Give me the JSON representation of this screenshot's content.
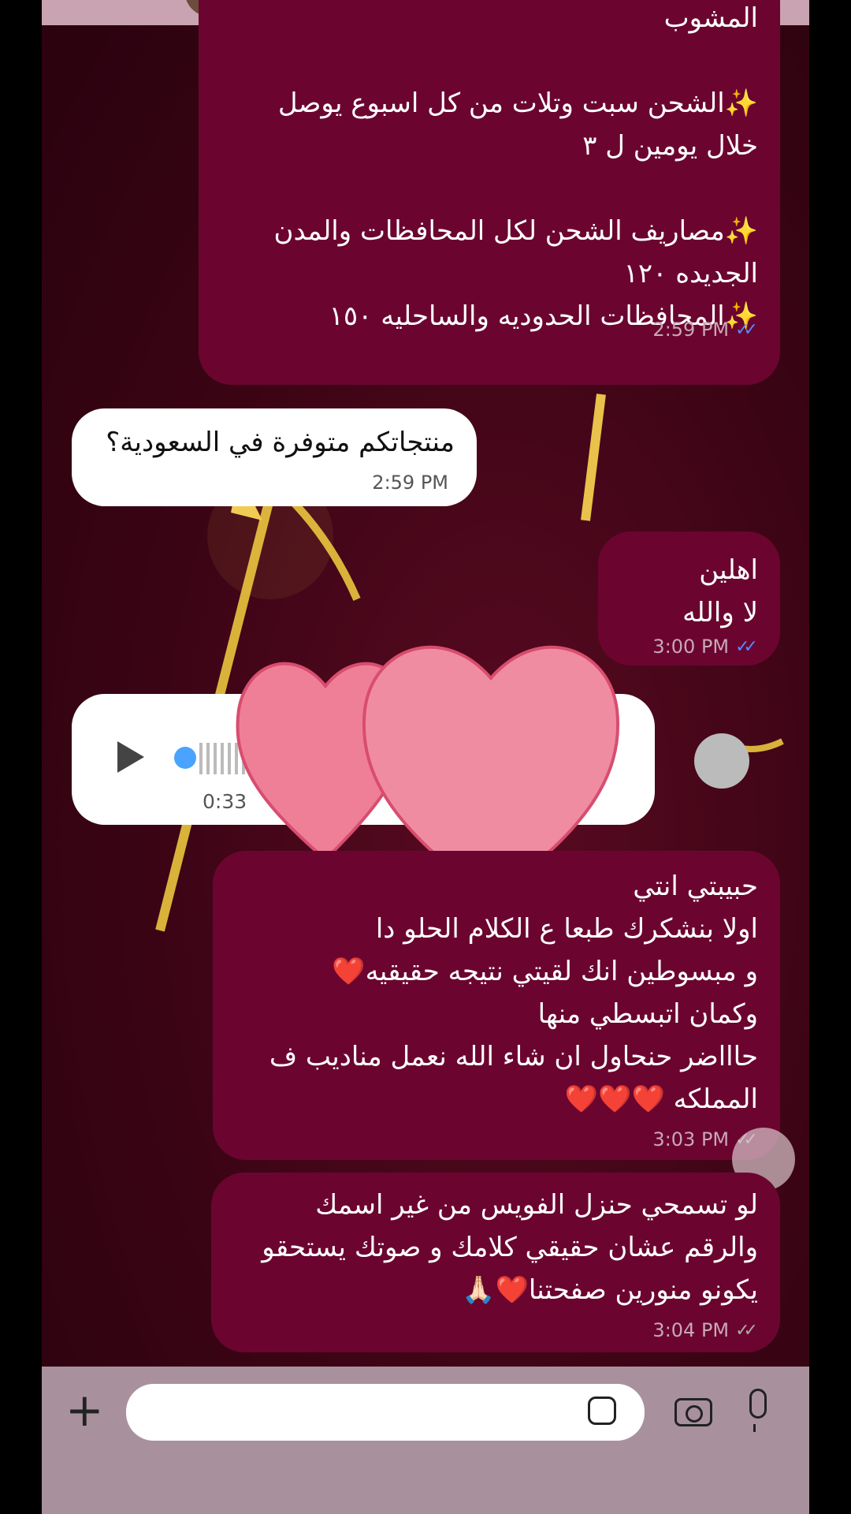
{
  "messages": [
    {
      "id": "m1",
      "dir": "out",
      "text": "المشوب\n\n✨الشحن سبت وتلات من كل اسبوع يوصل\nخلال يومين ل ٣\n\n✨مصاريف الشحن لكل المحافظات والمدن\nالجديده ١٢٠\n✨المحافظات الحدوديه والساحليه ١٥٠",
      "time": "2:59 PM",
      "status": "read"
    },
    {
      "id": "m2",
      "dir": "in",
      "text": "منتجاتكم متوفرة في السعودية؟",
      "time": "2:59 PM"
    },
    {
      "id": "m3",
      "dir": "out",
      "text": "اهلين\nلا والله",
      "time": "3:00 PM",
      "status": "read"
    },
    {
      "id": "m4",
      "dir": "in",
      "type": "voice",
      "duration": "0:33",
      "duration2": "3"
    },
    {
      "id": "m5",
      "dir": "out",
      "text": "حبيبتي انتي\nاولا بنشكرك طبعا ع الكلام الحلو دا\nو مبسوطين انك لقيتي نتيجه حقيقيه❤️\nوكمان اتبسطي منها\nحاااضر حنحاول ان شاء الله نعمل مناديب ف\nالمملكه ❤️❤️❤️",
      "time": "3:03 PM",
      "status": "delivered"
    },
    {
      "id": "m6",
      "dir": "out",
      "text": "لو تسمحي حنزل الفويس من غير اسمك\nوالرقم عشان حقيقي كلامك و صوتك يستحقو\nيكونو منورين صفحتنا❤️🙏🏻",
      "time": "3:04 PM",
      "status": "delivered"
    }
  ],
  "composer": {
    "placeholder": ""
  },
  "icons": {
    "plus": "plus-icon",
    "sticker": "sticker-icon",
    "camera": "camera-icon",
    "mic": "microphone-icon",
    "play": "play-icon"
  },
  "colors": {
    "outgoing": "#6b0530",
    "incoming": "#ffffff",
    "read_tick": "#4f8cff",
    "bottom_bar": "#a8919d"
  }
}
